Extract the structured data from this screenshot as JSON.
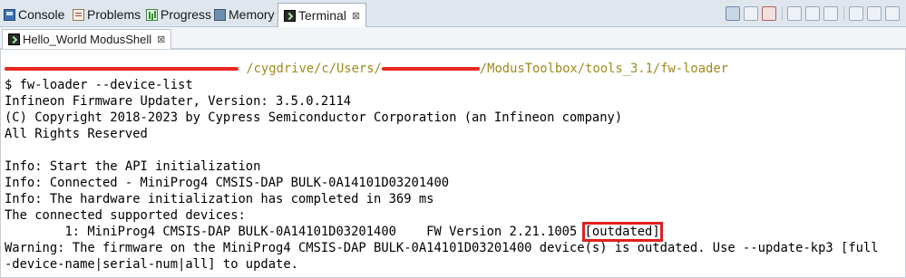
{
  "tabs": [
    {
      "label": "Console",
      "icon": "console-icon"
    },
    {
      "label": "Problems",
      "icon": "problems-icon"
    },
    {
      "label": "Progress",
      "icon": "progress-icon"
    },
    {
      "label": "Memory",
      "icon": "memory-icon"
    },
    {
      "label": "Terminal",
      "icon": "terminal-icon",
      "close": "⊠"
    }
  ],
  "subtab": {
    "label": "Hello_World ModusShell",
    "close": "⊠"
  },
  "terminal": {
    "prompt_path": "/cygdrive/c/Users/",
    "prompt_path_tail": "/ModusToolbox/tools_3.1/fw-loader",
    "command": "$ fw-loader --device-list",
    "lines": [
      "Infineon Firmware Updater, Version: 3.5.0.2114",
      "(C) Copyright 2018-2023 by Cypress Semiconductor Corporation (an Infineon company)",
      "All Rights Reserved",
      "",
      "Info: Start the API initialization",
      "Info: Connected - MiniProg4 CMSIS-DAP BULK-0A14101D03201400",
      "Info: The hardware initialization has completed in 369 ms",
      "The connected supported devices:"
    ],
    "device_line": "        1: MiniProg4 CMSIS-DAP BULK-0A14101D03201400    FW Version 2.21.1005 ",
    "device_status": "[outdated]",
    "warning_1": "Warning: The firmware on the MiniProg4 CMSIS-DAP BULK-0A14101D03201400 device(s) is outdated. Use --update-kp3 [full",
    "warning_2": "-device-name|serial-num|all] to update."
  },
  "colors": {
    "path": "#a08a1e",
    "redaction": "#e8271e",
    "highlight_box": "#e02020",
    "tab_bar": "#dfe6ee"
  }
}
